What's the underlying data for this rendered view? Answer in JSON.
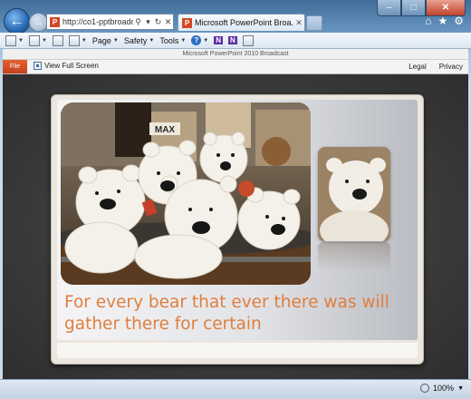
{
  "browser": {
    "address_url": "http://co1-pptbroadca...",
    "tab_title": "Microsoft PowerPoint Broa...",
    "favicon_letter": "P",
    "caption": {
      "minimize": "–",
      "maximize": "□",
      "close": "✕"
    },
    "toolbar_icons": [
      "home-icon",
      "favorites-star-icon",
      "tools-gear-icon"
    ],
    "commands": {
      "page": "Page",
      "safety": "Safety",
      "tools": "Tools",
      "help": "?",
      "onenote": "N"
    }
  },
  "app": {
    "window_title": "Microsoft PowerPoint 2010 Broadcast",
    "file_label": "File",
    "view_full_screen": "View Full Screen",
    "legal": "Legal",
    "privacy": "Privacy"
  },
  "slide": {
    "caption": "For every bear that ever there was will gather there for certain",
    "caption_color": "#e07e3c",
    "main_photo_sign": "MAX"
  },
  "status": {
    "zoom": "100%"
  }
}
